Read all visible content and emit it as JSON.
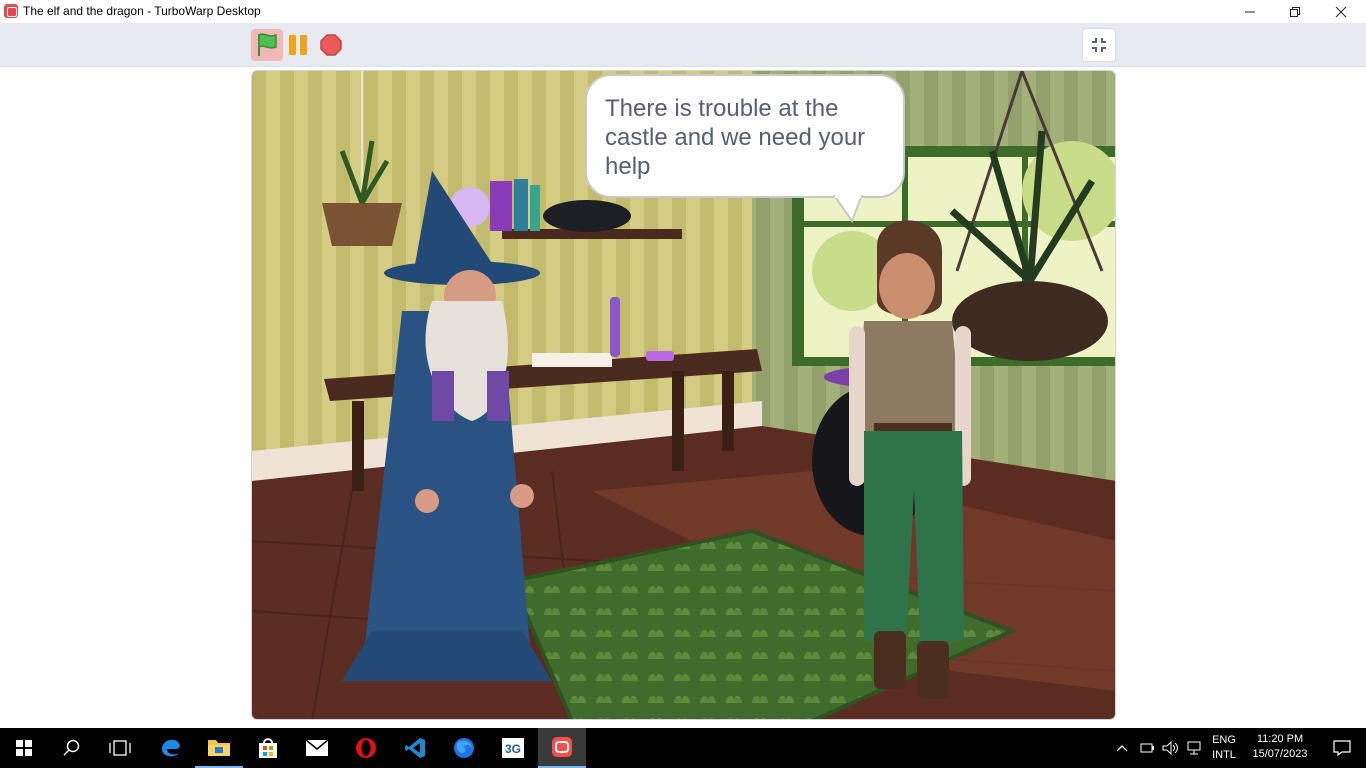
{
  "window": {
    "title": "The elf and the dragon - TurboWarp Desktop",
    "minimize_icon": "minimize-icon",
    "maximize_icon": "restore-icon",
    "close_icon": "close-icon"
  },
  "toolbar": {
    "green_flag_icon": "green-flag-icon",
    "pause_icon": "pause-icon",
    "stop_icon": "stop-icon",
    "fullscreen_icon": "exit-fullscreen-icon"
  },
  "stage": {
    "speech_bubble": "There is trouble at the castle and we need your help",
    "speaker": "elf"
  },
  "taskbar": {
    "apps": [
      "start",
      "search",
      "task-view",
      "edge",
      "file-explorer",
      "store",
      "mail",
      "opera",
      "vscode",
      "firefox",
      "3g-app",
      "turbowarp"
    ],
    "language_top": "ENG",
    "language_bottom": "INTL",
    "time": "11:20 PM",
    "date": "15/07/2023"
  },
  "colors": {
    "accent_blue": "#76b9ed",
    "toolbar_bg": "#e7ebf1",
    "bubble_text": "#575e75"
  }
}
